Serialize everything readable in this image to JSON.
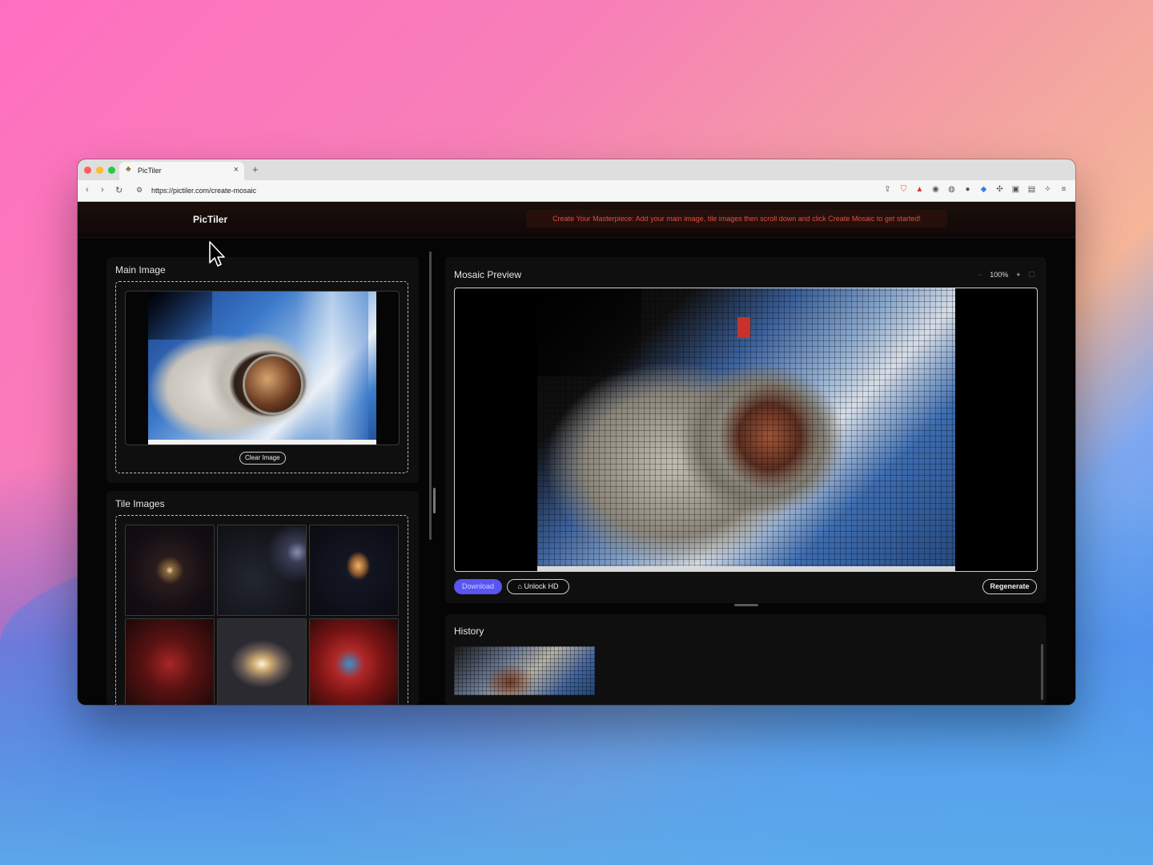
{
  "browser": {
    "tab_title": "PicTiler",
    "tab_close": "×",
    "new_tab": "+",
    "url": "https://pictiler.com/create-mosaic",
    "nav_back": "‹",
    "nav_forward": "›",
    "nav_reload": "↻"
  },
  "header": {
    "logo": "PicTiler",
    "banner": "Create Your Masterpiece: Add your main image, tile images then scroll down and click Create Mosaic to get started!"
  },
  "main_image": {
    "title": "Main Image",
    "clear_button": "Clear Image"
  },
  "tile_images": {
    "title": "Tile Images"
  },
  "mosaic": {
    "title": "Mosaic Preview",
    "zoom_out": "−",
    "zoom_level": "100%",
    "zoom_in": "+",
    "download": "Download",
    "unlock_hd": "Unlock HD",
    "regenerate": "Regenerate"
  },
  "history": {
    "title": "History"
  },
  "colors": {
    "accent": "#5a55f0",
    "banner_text": "#e0513e",
    "page_bg": "#050505",
    "panel_bg": "#0f0f0f"
  }
}
